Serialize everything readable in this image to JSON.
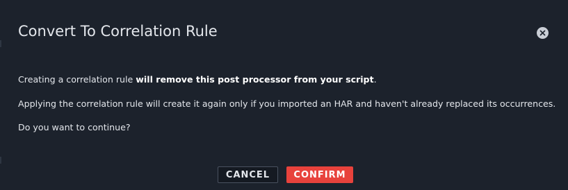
{
  "dialog": {
    "title": "Convert To Correlation Rule",
    "close_icon": "close-icon",
    "paragraph1": {
      "prefix": "Creating a correlation rule ",
      "bold": "will remove this post processor from your script",
      "suffix": "."
    },
    "paragraph2": "Applying the correlation rule will create it again only if you imported an HAR and haven't already replaced its occurrences.",
    "paragraph3": "Do you want to continue?",
    "buttons": {
      "cancel_label": "CANCEL",
      "confirm_label": "CONFIRM"
    }
  },
  "colors": {
    "background": "#1c222c",
    "text": "#e4e7ec",
    "confirm_accent": "#e8423c",
    "cancel_border": "#4a5260"
  }
}
